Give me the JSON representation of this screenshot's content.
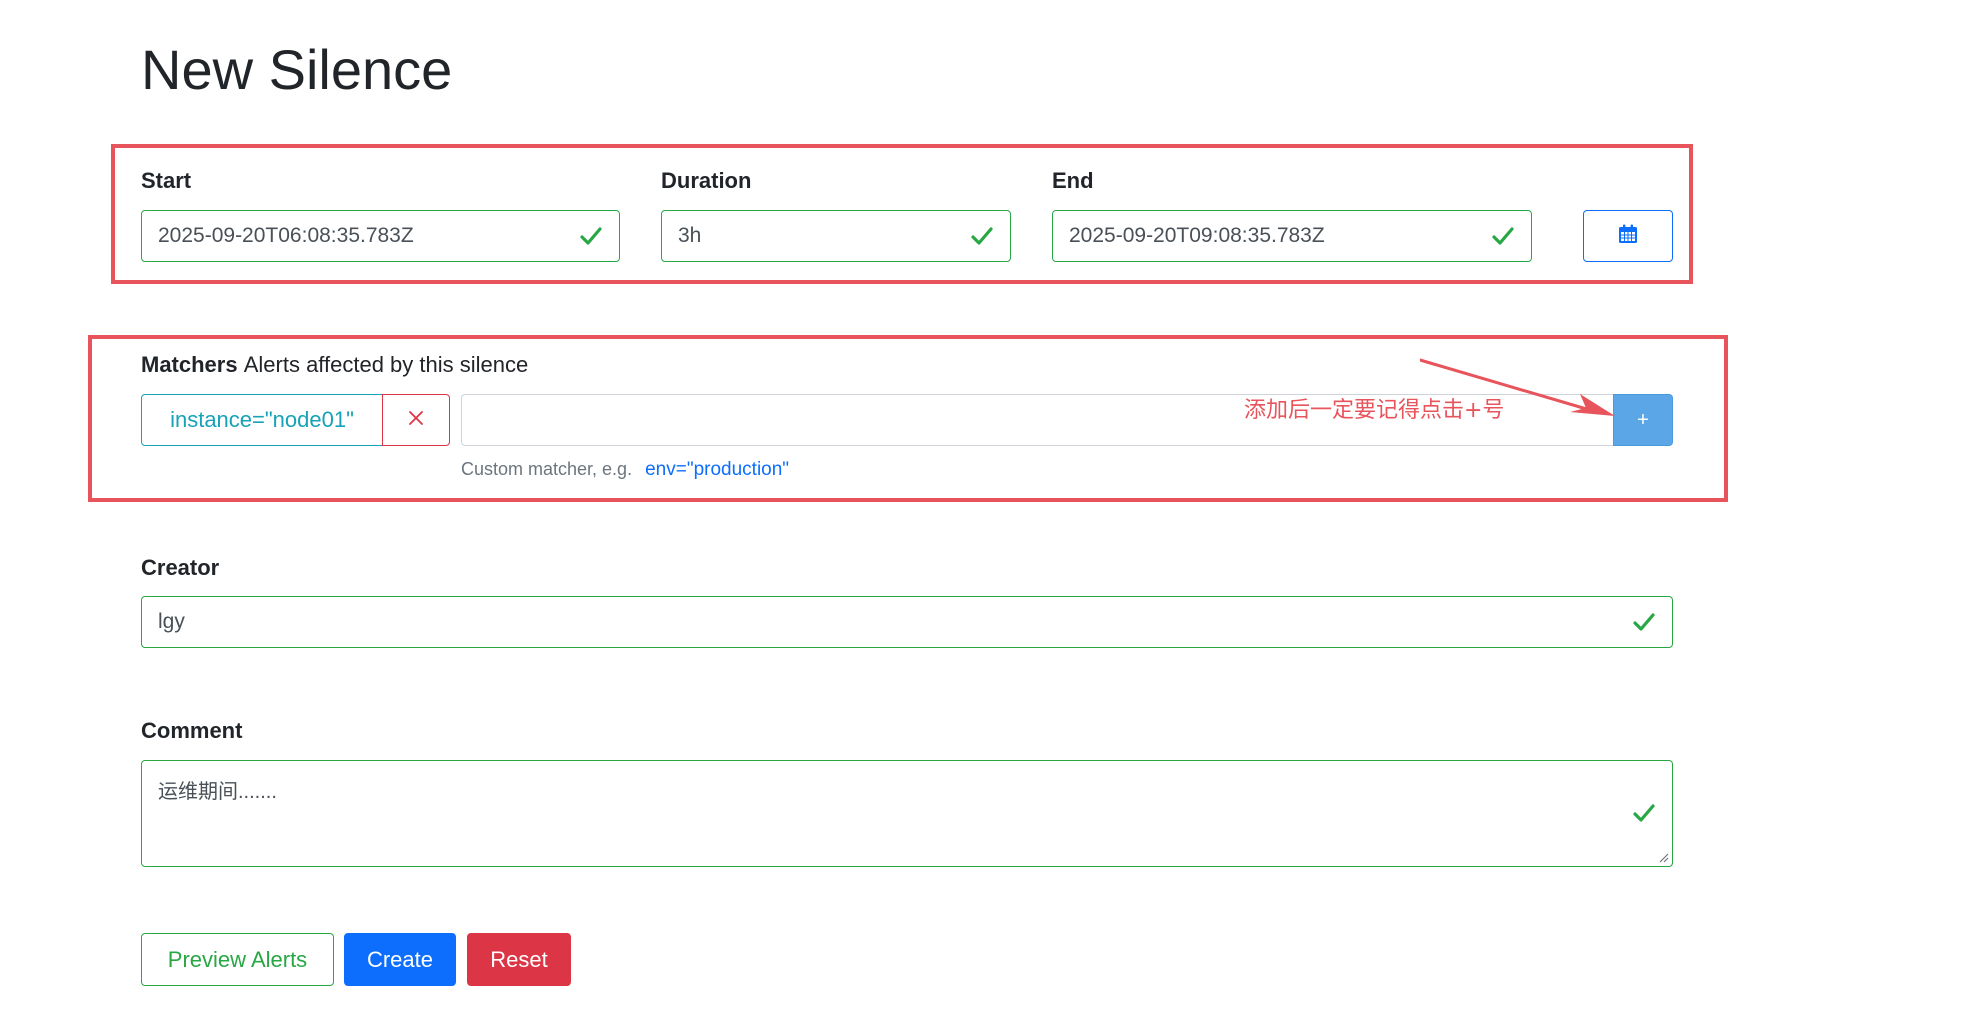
{
  "page": {
    "title": "New Silence"
  },
  "time": {
    "start": {
      "label": "Start",
      "value": "2025-09-20T06:08:35.783Z"
    },
    "duration": {
      "label": "Duration",
      "value": "3h"
    },
    "end": {
      "label": "End",
      "value": "2025-09-20T09:08:35.783Z"
    },
    "calendar_icon": "calendar-icon"
  },
  "matchers": {
    "label": "Matchers",
    "note": "Alerts affected by this silence",
    "items": [
      {
        "text": "instance=\"node01\""
      }
    ],
    "input_value": "",
    "add_label": "+",
    "helper_text": "Custom matcher, e.g.",
    "helper_example": "env=\"production\""
  },
  "annotation": {
    "text": "添加后一定要记得点击+号",
    "color": "#e8545c"
  },
  "creator": {
    "label": "Creator",
    "value": "lgy"
  },
  "comment": {
    "label": "Comment",
    "value": "运维期间......."
  },
  "buttons": {
    "preview": "Preview Alerts",
    "create": "Create",
    "reset": "Reset"
  },
  "colors": {
    "valid": "#28a745",
    "primary": "#0d6efd",
    "danger": "#dc3545",
    "info": "#17a2b8"
  }
}
